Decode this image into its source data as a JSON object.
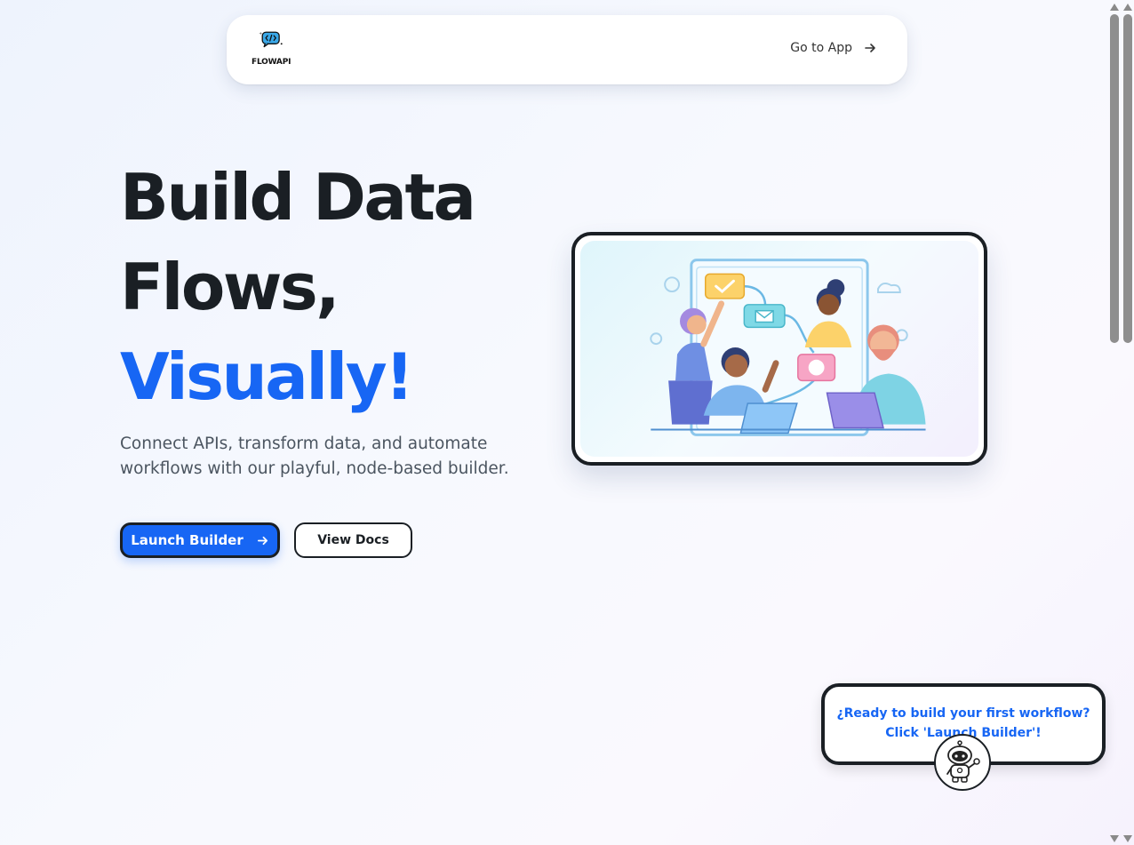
{
  "navbar": {
    "logo_text": "FLOWAPI",
    "logo_icon": "code-bubble-icon",
    "go_to_app": "Go to App",
    "go_to_app_icon": "arrow-right-icon"
  },
  "hero": {
    "title_line1": "Build Data",
    "title_line2": "Flows,",
    "title_line3": "Visually!",
    "subtitle": "Connect APIs, transform data, and automate workflows with our playful, node-based builder.",
    "primary_button": "Launch Builder",
    "secondary_button": "View Docs"
  },
  "illustration": {
    "description_icon": "team-collaboration-illustration"
  },
  "helper": {
    "message_line1": "¿Ready to build your first workflow?",
    "message_line2": "Click 'Launch Builder'!",
    "avatar_icon": "robot-assistant-icon"
  },
  "colors": {
    "accent": "#1766f4",
    "text_dark": "#1a1f24",
    "text_muted": "#4b5560"
  }
}
